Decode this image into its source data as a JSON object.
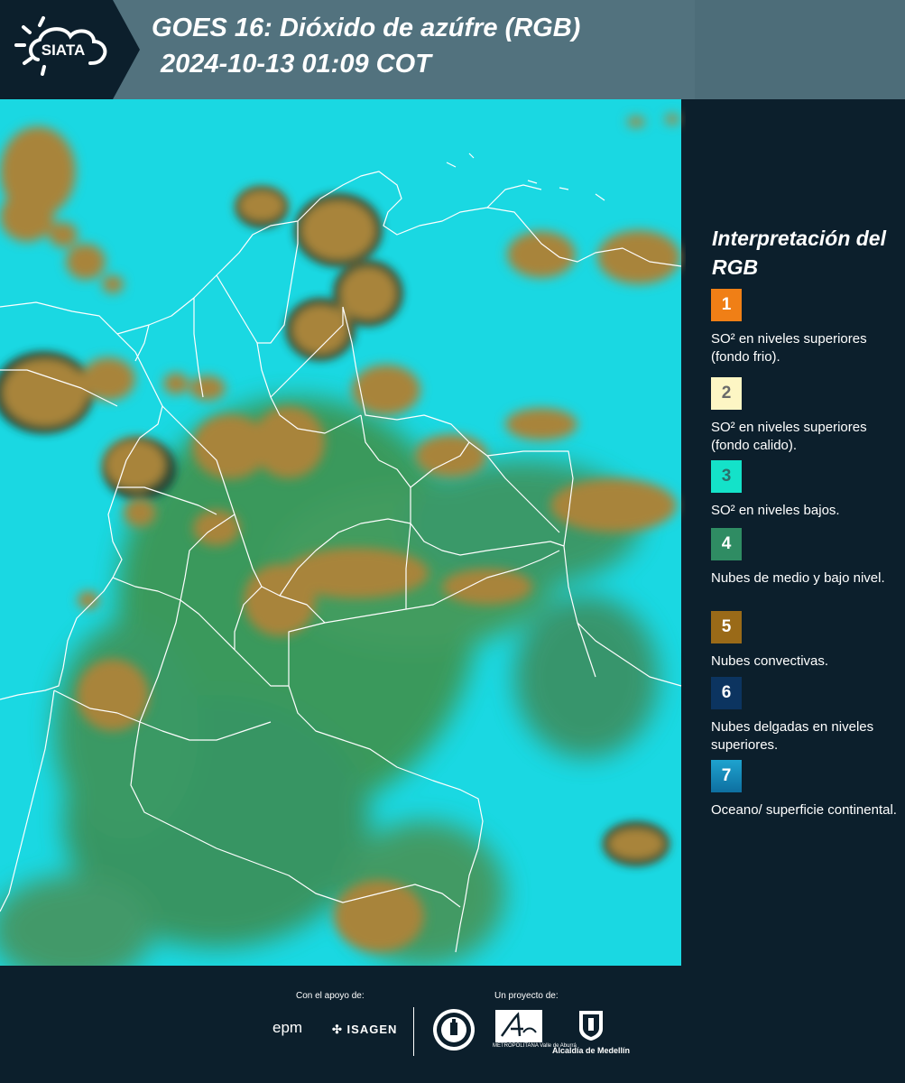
{
  "header": {
    "logo_text": "SIATA",
    "title_line_1": "GOES 16: Dióxido de azúfre (RGB)",
    "title_line_2": "2024-10-13 01:09 COT"
  },
  "legend": {
    "title": "Interpretación del RGB",
    "items": [
      {
        "number": "1",
        "color": "#f07f16",
        "text": "SO² en niveles superiores (fondo frio)."
      },
      {
        "number": "2",
        "color": "#fdf6c4",
        "text": "SO² en niveles superiores (fondo calido)."
      },
      {
        "number": "3",
        "color": "#14e2c9",
        "text": "SO² en niveles bajos."
      },
      {
        "number": "4",
        "color": "#2f8c63",
        "text": "Nubes de medio y bajo nivel."
      },
      {
        "number": "5",
        "color": "#9a6a18",
        "text": "Nubes convectivas."
      },
      {
        "number": "6",
        "color": "#0c3460",
        "text": "Nubes delgadas en niveles superiores."
      },
      {
        "number": "7",
        "color": "#1790c0",
        "text": "Oceano/ superficie continental."
      }
    ]
  },
  "map": {
    "colors": {
      "background": "#1ad8e2",
      "convective": "#a8843a",
      "green": "#3a8c4a",
      "border": "#ffffff"
    }
  },
  "footer": {
    "support_label": "Con el apoyo de:",
    "project_label": "Un proyecto de:",
    "sponsor_epm": "epm",
    "sponsor_isagen": "ISAGEN",
    "area_label": "METROPOLITANA Valle de Aburrá",
    "alcaldia_label": "Alcaldía de Medellín"
  }
}
